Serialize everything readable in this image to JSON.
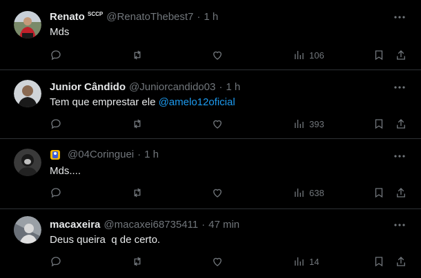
{
  "tweets": [
    {
      "name": "Renato",
      "name_suffix": "SCCP",
      "handle": "@RenatoThebest7",
      "time": "1 h",
      "text": "Mds",
      "views": "106"
    },
    {
      "name": "Junior Cândido",
      "handle": "@Juniorcandido03",
      "time": "1 h",
      "text": "Tem que emprestar ele ",
      "mention": "@amelo12oficial",
      "views": "393"
    },
    {
      "name": "",
      "handle": "@04Coringuei",
      "time": "1 h",
      "text": "Mds....",
      "views": "638"
    },
    {
      "name": "macaxeira",
      "handle": "@macaxei68735411",
      "time": "47 min",
      "text": "Deus queira  q de certo.",
      "views": "14"
    }
  ],
  "separator": "·",
  "colors": {
    "bg": "#000000",
    "text": "#e7e9ea",
    "muted": "#71767b",
    "link": "#1d9bf0",
    "border": "#2f3336"
  },
  "icons": [
    "more-icon",
    "reply-icon",
    "retweet-icon",
    "like-icon",
    "views-icon",
    "bookmark-icon",
    "share-icon"
  ]
}
